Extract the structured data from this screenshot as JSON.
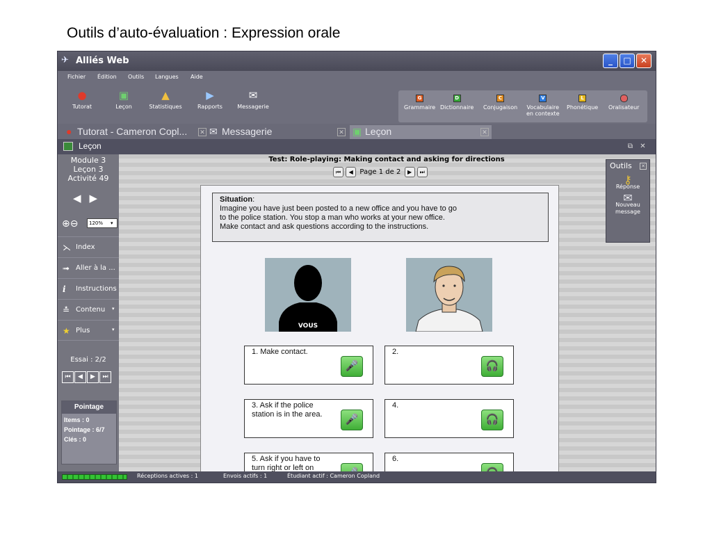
{
  "slide_title": "Outils d’auto-évaluation : Expression orale",
  "window": {
    "title": "Alliés Web"
  },
  "menu": [
    "Fichier",
    "Édition",
    "Outils",
    "Langues",
    "Aide"
  ],
  "toolbar": {
    "left": [
      {
        "label": "Tutorat",
        "icon": "apple-icon"
      },
      {
        "label": "Leçon",
        "icon": "lesson-monitor-icon"
      },
      {
        "label": "Statistiques",
        "icon": "statistics-chart-icon"
      },
      {
        "label": "Rapports",
        "icon": "reports-folder-icon"
      },
      {
        "label": "Messagerie",
        "icon": "message-icon"
      }
    ],
    "right": [
      {
        "label": "Grammaire",
        "letter": "G",
        "color": "#e05a1e"
      },
      {
        "label": "Dictionnaire",
        "letter": "D",
        "color": "#38a63a"
      },
      {
        "label": "Conjugaison",
        "letter": "C",
        "color": "#e08a1e"
      },
      {
        "label": "Vocabulaire",
        "label2": "en contexte",
        "letter": "V",
        "color": "#2a7ae0"
      },
      {
        "label": "Phonétique",
        "letter": "L",
        "color": "#e6b81e"
      },
      {
        "label": "Oralisateur",
        "letter": "",
        "color": "#e06060"
      }
    ]
  },
  "tabs": [
    {
      "label": "Tutorat - Cameron Copl..."
    },
    {
      "label": "Messagerie"
    },
    {
      "label": "Leçon"
    }
  ],
  "lesson_bar": {
    "title": "Leçon"
  },
  "left_panel": {
    "module": "Module 3",
    "lecon": "Leçon 3",
    "activite": "Activité 49",
    "zoom": "120%",
    "items": [
      {
        "label": "Index",
        "caret": ""
      },
      {
        "label": "Aller à la ...",
        "caret": ""
      },
      {
        "label": "Instructions",
        "caret": ""
      },
      {
        "label": "Contenu",
        "caret": "▾"
      },
      {
        "label": "Plus",
        "caret": "▾"
      }
    ],
    "essai": "Essai : 2/2",
    "score": {
      "header": "Pointage",
      "items": "Items : 0",
      "pointage": "Pointage : 6/7",
      "cles": "Clés : 0"
    }
  },
  "content": {
    "test_title": "Test: Role-playing: Making contact and asking for directions",
    "page": "Page 1 de 2",
    "situation_heading": "Situation",
    "situation_lines": [
      "Imagine you have just been posted to a new office and you have to go",
      "to the police station. You stop a man who works at your new office.",
      "Make contact and ask questions according to the instructions."
    ],
    "vous_label": "VOUS",
    "boxes": [
      {
        "text": "1. Make contact.",
        "kind": "mic"
      },
      {
        "text": "2.",
        "kind": "headphones"
      },
      {
        "text": "3. Ask if the police station is in the area.",
        "kind": "mic"
      },
      {
        "text": "4.",
        "kind": "headphones"
      },
      {
        "text": "5. Ask if you have to turn right or left on",
        "kind": "mic"
      },
      {
        "text": "6.",
        "kind": "headphones"
      }
    ]
  },
  "outils": {
    "title": "Outils",
    "tools": [
      {
        "label": "Réponse"
      },
      {
        "label": "Nouveau message"
      }
    ]
  },
  "status": {
    "receptions": "Réceptions actives : 1",
    "envois": "Envois actifs : 1",
    "etudiant": "Étudiant actif : Cameron Copland"
  }
}
